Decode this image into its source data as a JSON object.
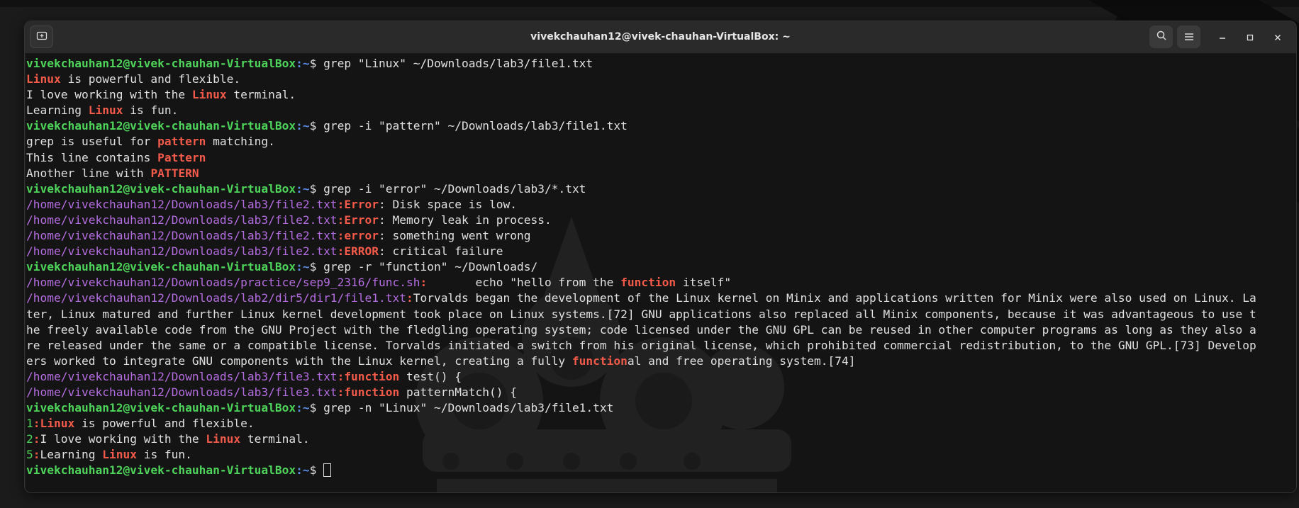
{
  "window": {
    "title": "vivekchauhan12@vivek-chauhan-VirtualBox: ~"
  },
  "prompt": {
    "user_host": "vivekchauhan12@vivek-chauhan-VirtualBox",
    "path": ":~",
    "symbol": "$ "
  },
  "lines": [
    {
      "type": "cmd",
      "text": "grep \"Linux\" ~/Downloads/lab3/file1.txt"
    },
    {
      "type": "out",
      "segs": [
        {
          "m": "Linux"
        },
        {
          "t": " is powerful and flexible."
        }
      ]
    },
    {
      "type": "out",
      "segs": [
        {
          "t": "I love working with the "
        },
        {
          "m": "Linux"
        },
        {
          "t": " terminal."
        }
      ]
    },
    {
      "type": "out",
      "segs": [
        {
          "t": "Learning "
        },
        {
          "m": "Linux"
        },
        {
          "t": " is fun."
        }
      ]
    },
    {
      "type": "cmd",
      "text": "grep -i \"pattern\" ~/Downloads/lab3/file1.txt"
    },
    {
      "type": "out",
      "segs": [
        {
          "t": "grep is useful for "
        },
        {
          "m": "pattern"
        },
        {
          "t": " matching."
        }
      ]
    },
    {
      "type": "out",
      "segs": [
        {
          "t": "This line contains "
        },
        {
          "m": "Pattern"
        }
      ]
    },
    {
      "type": "out",
      "segs": [
        {
          "t": "Another line with "
        },
        {
          "m": "PATTERN"
        }
      ]
    },
    {
      "type": "cmd",
      "text": "grep -i \"error\" ~/Downloads/lab3/*.txt"
    },
    {
      "type": "out",
      "segs": [
        {
          "f": "/home/vivekchauhan12/Downloads/lab3/file2.txt"
        },
        {
          "m": ":"
        },
        {
          "m": "Error"
        },
        {
          "t": ": Disk space is low."
        }
      ]
    },
    {
      "type": "out",
      "segs": [
        {
          "f": "/home/vivekchauhan12/Downloads/lab3/file2.txt"
        },
        {
          "m": ":"
        },
        {
          "m": "Error"
        },
        {
          "t": ": Memory leak in process."
        }
      ]
    },
    {
      "type": "out",
      "segs": [
        {
          "f": "/home/vivekchauhan12/Downloads/lab3/file2.txt"
        },
        {
          "m": ":"
        },
        {
          "m": "error"
        },
        {
          "t": ": something went wrong"
        }
      ]
    },
    {
      "type": "out",
      "segs": [
        {
          "f": "/home/vivekchauhan12/Downloads/lab3/file2.txt"
        },
        {
          "m": ":"
        },
        {
          "m": "ERROR"
        },
        {
          "t": ": critical failure"
        }
      ]
    },
    {
      "type": "cmd",
      "text": "grep -r \"function\" ~/Downloads/"
    },
    {
      "type": "out",
      "segs": [
        {
          "f": "/home/vivekchauhan12/Downloads/practice/sep9_2316/func.sh"
        },
        {
          "m": ":"
        },
        {
          "t": "       echo \"hello from the "
        },
        {
          "m": "function"
        },
        {
          "t": " itself\""
        }
      ]
    },
    {
      "type": "out",
      "segs": [
        {
          "f": "/home/vivekchauhan12/Downloads/lab2/dir5/dir1/file1.txt"
        },
        {
          "m": ":"
        },
        {
          "t": "Torvalds began the development of the Linux kernel on Minix and applications written for Minix were also used on Linux. La"
        }
      ]
    },
    {
      "type": "out",
      "segs": [
        {
          "t": "ter, Linux matured and further Linux kernel development took place on Linux systems.[72] GNU applications also replaced all Minix components, because it was advantageous to use t"
        }
      ]
    },
    {
      "type": "out",
      "segs": [
        {
          "t": "he freely available code from the GNU Project with the fledgling operating system; code licensed under the GNU GPL can be reused in other computer programs as long as they also a"
        }
      ]
    },
    {
      "type": "out",
      "segs": [
        {
          "t": "re released under the same or a compatible license. Torvalds initiated a switch from his original license, which prohibited commercial redistribution, to the GNU GPL.[73] Develop"
        }
      ]
    },
    {
      "type": "out",
      "segs": [
        {
          "t": "ers worked to integrate GNU components with the Linux kernel, creating a fully "
        },
        {
          "m": "function"
        },
        {
          "t": "al and free operating system.[74]"
        }
      ]
    },
    {
      "type": "out",
      "segs": [
        {
          "f": "/home/vivekchauhan12/Downloads/lab3/file3.txt"
        },
        {
          "m": ":"
        },
        {
          "m": "function"
        },
        {
          "t": " test() {"
        }
      ]
    },
    {
      "type": "out",
      "segs": [
        {
          "f": "/home/vivekchauhan12/Downloads/lab3/file3.txt"
        },
        {
          "m": ":"
        },
        {
          "m": "function"
        },
        {
          "t": " patternMatch() {"
        }
      ]
    },
    {
      "type": "cmd",
      "text": "grep -n \"Linux\" ~/Downloads/lab3/file1.txt"
    },
    {
      "type": "out",
      "segs": [
        {
          "n": "1"
        },
        {
          "m": ":"
        },
        {
          "m": "Linux"
        },
        {
          "t": " is powerful and flexible."
        }
      ]
    },
    {
      "type": "out",
      "segs": [
        {
          "n": "2"
        },
        {
          "m": ":"
        },
        {
          "t": "I love working with the "
        },
        {
          "m": "Linux"
        },
        {
          "t": " terminal."
        }
      ]
    },
    {
      "type": "out",
      "segs": [
        {
          "n": "5"
        },
        {
          "m": ":"
        },
        {
          "t": "Learning "
        },
        {
          "m": "Linux"
        },
        {
          "t": " is fun."
        }
      ]
    },
    {
      "type": "prompt",
      "text": ""
    }
  ],
  "icons": {
    "new_tab": "new-tab-icon",
    "search": "search-icon",
    "menu": "hamburger-menu-icon",
    "minimize": "minimize-icon",
    "maximize": "maximize-icon",
    "close": "close-icon"
  },
  "colors": {
    "prompt_user": "#4ed45a",
    "prompt_path": "#5c8ee8",
    "filename": "#b46de0",
    "match": "#f25a4a",
    "text": "#e0e0e0"
  }
}
